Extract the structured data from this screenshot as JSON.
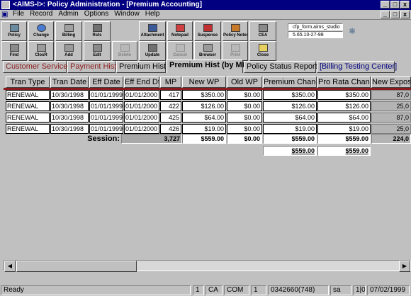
{
  "window": {
    "title": "<AIMS-I>: Policy Administration - [Premium Accounting]",
    "buttons": [
      "_",
      "□",
      "x"
    ]
  },
  "menu": {
    "items": [
      "File",
      "Record",
      "Admin",
      "Options",
      "Window",
      "Help"
    ],
    "buttons": [
      "_",
      "□",
      "x"
    ]
  },
  "toolbar": {
    "row1": [
      "Policy",
      "Change",
      "Billing",
      "Rsts",
      "Attachment",
      "Notepad",
      "Suspense",
      "Policy Notes",
      "CEA"
    ],
    "row2": [
      "Find",
      "ClosR",
      "Add",
      "Edit",
      "Delete",
      "Update",
      "Cancel",
      "Browser",
      "Print",
      "Close"
    ]
  },
  "info": {
    "field1": "cfp_form.aims_studio",
    "field2": "5.65.10-27-98"
  },
  "tabs": [
    "Customer Service",
    "Payment Hist",
    "Premium Hist",
    "Premium Hist (by MP)",
    "Policy Status Report",
    "[Billing Testing Center]"
  ],
  "grid": {
    "headers": [
      "Tran Type",
      "Tran Date",
      "Eff Date",
      "Eff End Dt",
      "MP",
      "New WP",
      "Old WP",
      "Premium Change",
      "Pro Rata Change",
      "New Exposu"
    ],
    "rows": [
      [
        "RENEWAL",
        "10/30/1998",
        "01/01/1999",
        "01/01/2000",
        "417",
        "$350.00",
        "$0.00",
        "$350.00",
        "$350.00",
        "87,0"
      ],
      [
        "RENEWAL",
        "10/30/1998",
        "01/01/1999",
        "01/01/2000",
        "422",
        "$126.00",
        "$0.00",
        "$126.00",
        "$126.00",
        "25,0"
      ],
      [
        "RENEWAL",
        "10/30/1998",
        "01/01/1999",
        "01/01/2000",
        "425",
        "$64.00",
        "$0.00",
        "$64.00",
        "$64.00",
        "87,0"
      ],
      [
        "RENEWAL",
        "10/30/1998",
        "01/01/1999",
        "01/01/2000",
        "426",
        "$19.00",
        "$0.00",
        "$19.00",
        "$19.00",
        "25,0"
      ]
    ],
    "session": {
      "label": "Session:",
      "mp": "3,727",
      "new_wp": "$559.00",
      "old_wp": "$0.00",
      "premium_change": "$559.00",
      "pro_rata_change": "$559.00",
      "new_exposure": "224,0"
    },
    "totals": {
      "premium_change": "$559.00",
      "pro_rata_change": "$559.00"
    }
  },
  "status": {
    "ready": "Ready",
    "p1": "1",
    "p2": "CA",
    "p3": "COM",
    "p4": "1",
    "p5": "0342660(748)",
    "p6": "sa",
    "p7": "1|0",
    "p8": "07/02/1999"
  }
}
